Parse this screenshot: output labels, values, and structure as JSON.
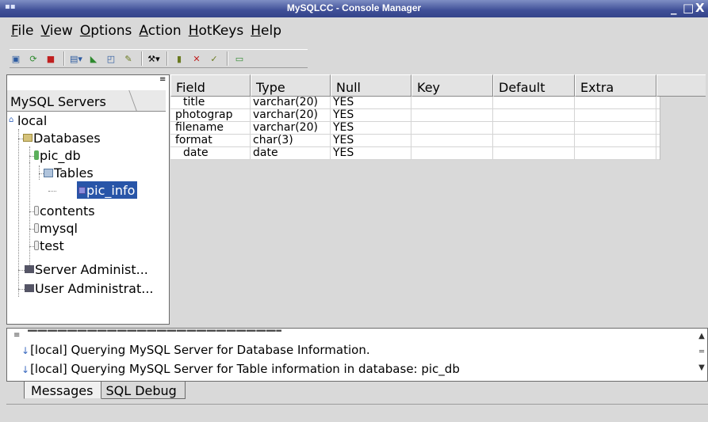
{
  "window": {
    "title": "MySQLCC - Console Manager"
  },
  "menu": {
    "items": [
      "File",
      "View",
      "Options",
      "Action",
      "HotKeys",
      "Help"
    ]
  },
  "left": {
    "header": "MySQL Servers",
    "tree": {
      "root": "local",
      "databases": "Databases",
      "db1": "pic_db",
      "tables": "Tables",
      "table1": "pic_info",
      "db2": "contents",
      "db3": "mysql",
      "db4": "test",
      "admin1": "Server Administ...",
      "admin2": "User Administrat..."
    }
  },
  "grid": {
    "headers": [
      "Field",
      "Type",
      "Null",
      "Key",
      "Default",
      "Extra"
    ],
    "rows": [
      [
        "title",
        "varchar(20)",
        "YES",
        "",
        "",
        ""
      ],
      [
        "photograp",
        "varchar(20)",
        "YES",
        "",
        "",
        ""
      ],
      [
        "filename",
        "varchar(20)",
        "YES",
        "",
        "",
        ""
      ],
      [
        "format",
        "char(3)",
        "YES",
        "",
        "",
        ""
      ],
      [
        "date",
        "date",
        "YES",
        "",
        "",
        ""
      ]
    ]
  },
  "messages": {
    "lines": [
      "[local] Querying MySQL Server for Database Information.",
      "[local] Querying MySQL Server for Table information in database: pic_db"
    ]
  },
  "tabs": [
    "Messages",
    "SQL Debug"
  ]
}
